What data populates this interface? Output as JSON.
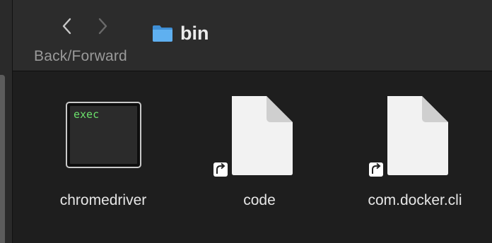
{
  "toolbar": {
    "nav_label": "Back/Forward",
    "title": "bin",
    "back_icon": "chevron-left-icon",
    "forward_icon": "chevron-right-icon",
    "folder_icon": "folder-icon"
  },
  "files": [
    {
      "name": "chromedriver",
      "kind": "executable",
      "icon": "exec",
      "thumb_text": "exec"
    },
    {
      "name": "code",
      "kind": "alias",
      "icon": "document-alias-icon"
    },
    {
      "name": "com.docker.cli",
      "kind": "alias",
      "icon": "document-alias-icon"
    }
  ],
  "colors": {
    "background": "#1e1e1e",
    "toolbar": "#2c2c2c",
    "folder_blue": "#4fa3e8",
    "exec_green": "#6be06b"
  }
}
